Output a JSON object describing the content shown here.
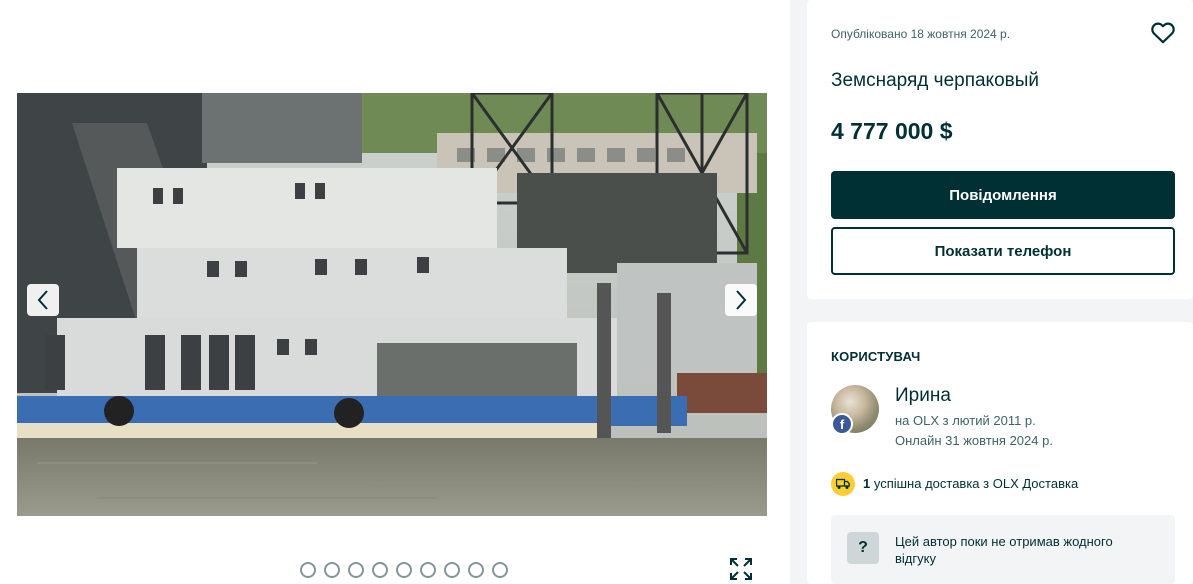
{
  "gallery": {
    "total_photos": 9,
    "active_photo": 1
  },
  "ad": {
    "posted_date": "Опубліковано 18 жовтня 2024 р.",
    "title": "Земснаряд черпаковый",
    "price": "4 777 000 $",
    "message_button": "Повідомлення",
    "phone_button": "Показати телефон"
  },
  "seller": {
    "heading": "КОРИСТУВАЧ",
    "name": "Ирина",
    "since": "на OLX з лютий 2011 р.",
    "online": "Онлайн 31 жовтня 2024 р.",
    "delivery_count": "1",
    "delivery_text": " успішна доставка з OLX Доставка",
    "feedback_text": "Цей автор поки не отримав жодного відгуку",
    "avatar_badge": "f"
  },
  "colors": {
    "primary": "#002f34",
    "accent_yellow": "#ffce32",
    "facebook": "#3b5998",
    "page_bg": "#f2f4f5"
  },
  "icons": [
    "chevron-left-icon",
    "chevron-right-icon",
    "heart-icon",
    "fullscreen-icon",
    "truck-icon",
    "question-icon",
    "facebook-icon"
  ]
}
